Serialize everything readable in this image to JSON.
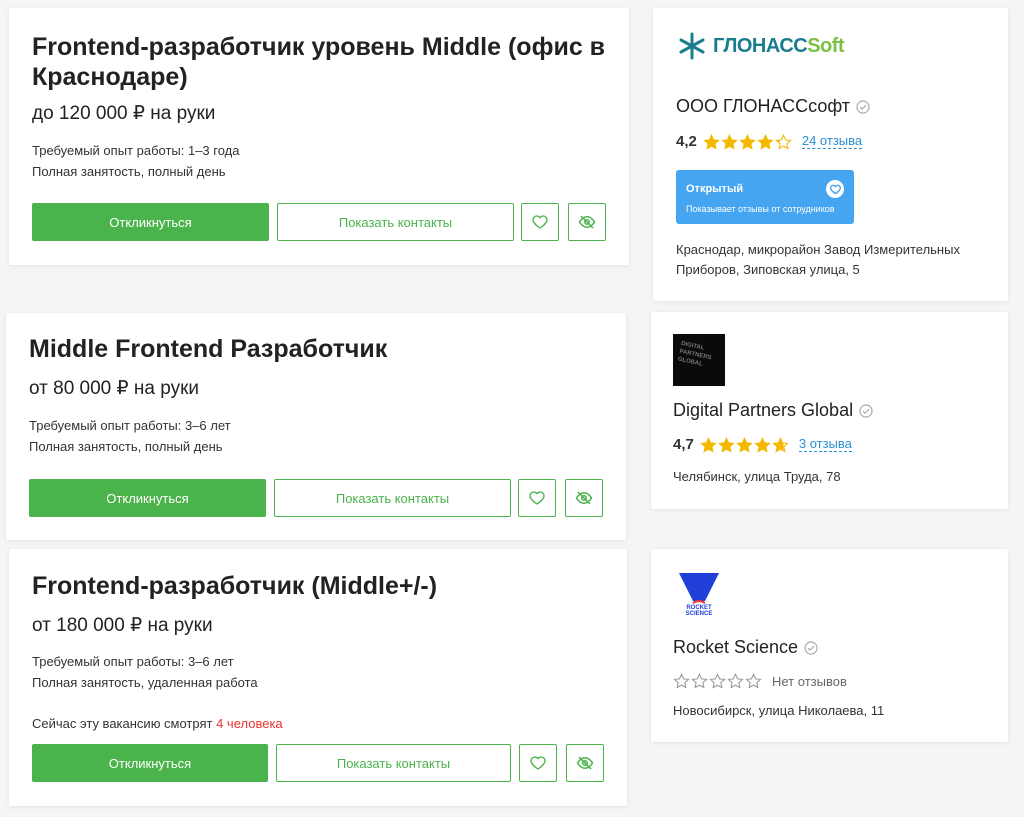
{
  "vacancies": [
    {
      "title": "Frontend-разработчик уровень Middle (офис в Краснодаре)",
      "salary": "до 120 000 ₽ на руки",
      "experience": "Требуемый опыт работы: 1–3 года",
      "employment": "Полная занятость, полный день",
      "viewers_prefix": "",
      "viewers_count": "",
      "respond_label": "Откликнуться",
      "contacts_label": "Показать контакты"
    },
    {
      "title": "Middle Frontend Разработчик",
      "salary": "от 80 000 ₽ на руки",
      "experience": "Требуемый опыт работы: 3–6 лет",
      "employment": "Полная занятость, полный день",
      "viewers_prefix": "",
      "viewers_count": "",
      "respond_label": "Откликнуться",
      "contacts_label": "Показать контакты"
    },
    {
      "title": "Frontend-разработчик (Middle+/-)",
      "salary": "от 180 000 ₽ на руки",
      "experience": "Требуемый опыт работы: 3–6 лет",
      "employment": "Полная занятость, удаленная работа",
      "viewers_prefix": "Сейчас эту вакансию смотрят",
      "viewers_count": "4 человека",
      "respond_label": "Откликнуться",
      "contacts_label": "Показать контакты"
    }
  ],
  "companies": [
    {
      "logo_text_1": "ГЛОНАСС",
      "logo_text_2": "Soft",
      "name": "ООО ГЛОНАССсофт",
      "rating": "4,2",
      "rating_value": 4.2,
      "reviews": "24 отзыва",
      "badge_title": "Открытый",
      "badge_subtitle": "Показывает отзывы от сотрудников",
      "address_line1": "Краснодар, микрорайон Завод Измерительных",
      "address_line2": "Приборов, Зиповская улица, 5"
    },
    {
      "logo_text": "DIGITAL PARTNERS GLOBAL",
      "name": "Digital Partners Global",
      "rating": "4,7",
      "rating_value": 4.7,
      "reviews": "3 отзыва",
      "address_line1": "Челябинск, улица Труда, 78"
    },
    {
      "logo_text": "ROCKET SCIENCE",
      "name": "Rocket Science",
      "rating_value": 0,
      "reviews": "Нет отзывов",
      "address_line1": "Новосибирск, улица Николаева, 11"
    }
  ],
  "icons": {
    "favorite": "heart-icon",
    "hide": "eye-off-icon",
    "verified": "check-circle-icon",
    "star": "star-icon"
  },
  "colors": {
    "accent_green": "#4bb34b",
    "star_yellow": "#f5b800",
    "link_blue": "#2d8fd6",
    "badge_blue": "#46a5f0",
    "viewers_red": "#ee3333",
    "glonass_teal": "#1a7d8f",
    "glonass_green": "#7ac143"
  }
}
